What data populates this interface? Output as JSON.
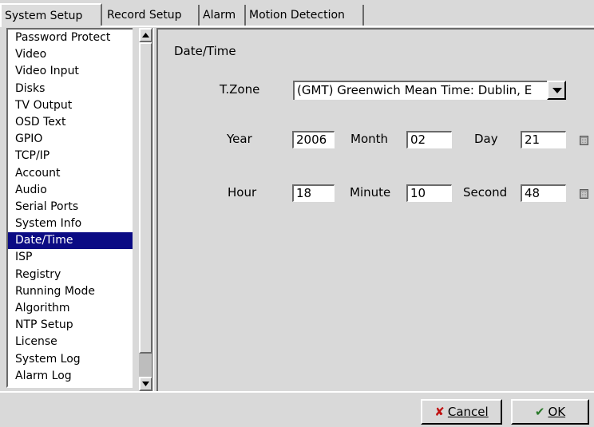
{
  "tabs": [
    {
      "label": "System Setup",
      "active": true
    },
    {
      "label": "Record Setup",
      "active": false
    },
    {
      "label": "Alarm",
      "active": false
    },
    {
      "label": "Motion Detection",
      "active": false
    }
  ],
  "sidebar": {
    "items": [
      {
        "label": "Password Protect"
      },
      {
        "label": "Video"
      },
      {
        "label": "Video Input"
      },
      {
        "label": "Disks"
      },
      {
        "label": "TV Output"
      },
      {
        "label": "OSD Text"
      },
      {
        "label": "GPIO"
      },
      {
        "label": "TCP/IP"
      },
      {
        "label": "Account"
      },
      {
        "label": "Audio"
      },
      {
        "label": "Serial Ports"
      },
      {
        "label": "System Info"
      },
      {
        "label": "Date/Time",
        "selected": true
      },
      {
        "label": "ISP"
      },
      {
        "label": "Registry"
      },
      {
        "label": "Running Mode"
      },
      {
        "label": "Algorithm"
      },
      {
        "label": "NTP Setup"
      },
      {
        "label": "License"
      },
      {
        "label": "System Log"
      },
      {
        "label": "Alarm Log"
      }
    ]
  },
  "main": {
    "section_title": "Date/Time",
    "timezone": {
      "label": "T.Zone",
      "value": "(GMT) Greenwich Mean Time: Dublin, E"
    },
    "date": {
      "year_label": "Year",
      "year_value": "2006",
      "month_label": "Month",
      "month_value": "02",
      "day_label": "Day",
      "day_value": "21"
    },
    "time": {
      "hour_label": "Hour",
      "hour_value": "18",
      "minute_label": "Minute",
      "minute_value": "10",
      "second_label": "Second",
      "second_value": "48"
    }
  },
  "footer": {
    "cancel_label": "Cancel",
    "cancel_icon": "cross-icon",
    "ok_label": "OK",
    "ok_icon": "checkmark-icon"
  },
  "colors": {
    "window_bg": "#d9d9d9",
    "selection_bg": "#0b0b84",
    "cancel_icon": "#c01010",
    "ok_icon": "#2a7a2a"
  }
}
